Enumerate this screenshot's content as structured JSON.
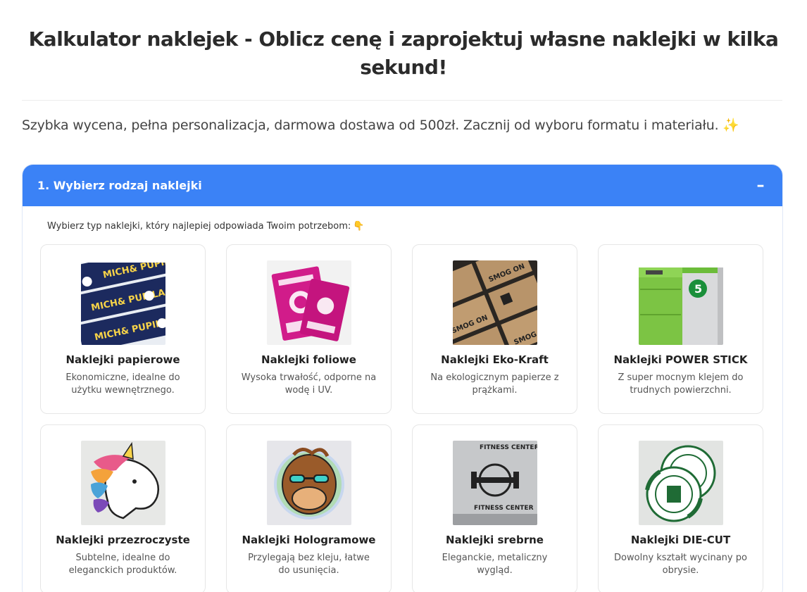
{
  "page": {
    "title": "Kalkulator naklejek - Oblicz cenę i zaprojektuj własne naklejki w kilka sekund!",
    "subtitle": "Szybka wycena, pełna personalizacja, darmowa dostawa od 500zł. Zacznij od wyboru formatu i materiału.",
    "subtitle_emoji": "✨"
  },
  "section": {
    "title": "1. Wybierz rodzaj naklejki",
    "toggle_symbol": "–",
    "instruction": "Wybierz typ naklejki, który najlepiej odpowiada Twoim potrzebom:",
    "instruction_emoji": "👇",
    "accent_color": "#3b82f6"
  },
  "stickers": [
    {
      "title": "Naklejki papierowe",
      "desc": "Ekonomiczne, idealne do użytku wewnętrznego.",
      "image": "paper-stickers-photo",
      "thumb_text": "MICH& PUPILA"
    },
    {
      "title": "Naklejki foliowe",
      "desc": "Wysoka trwałość, odporne na wodę i UV.",
      "image": "foil-stickers-photo"
    },
    {
      "title": "Naklejki Eko-Kraft",
      "desc": "Na ekologicznym papierze z prążkami.",
      "image": "kraft-stickers-photo",
      "thumb_text": "SMOG ON"
    },
    {
      "title": "Naklejki POWER STICK",
      "desc": "Z super mocnym klejem do trudnych powierzchni.",
      "image": "boiler-photo",
      "thumb_text": "5"
    },
    {
      "title": "Naklejki przezroczyste",
      "desc": "Subtelne, idealne do eleganckich produktów.",
      "image": "unicorn-sticker-photo"
    },
    {
      "title": "Naklejki Hologramowe",
      "desc": "Przylegają bez kleju, łatwe do usunięcia.",
      "image": "monkey-sticker-photo"
    },
    {
      "title": "Naklejki srebrne",
      "desc": "Eleganckie, metaliczny wygląd.",
      "image": "fitness-sticker-photo",
      "thumb_text": "FITNESS CENTER"
    },
    {
      "title": "Naklejki DIE-CUT",
      "desc": "Dowolny kształt wycinany po obrysie.",
      "image": "round-sticker-photo"
    }
  ]
}
